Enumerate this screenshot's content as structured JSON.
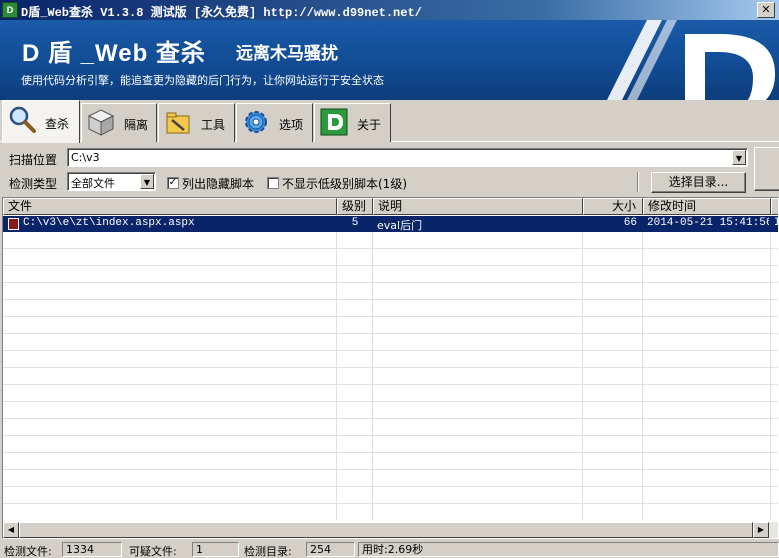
{
  "window": {
    "title": "D盾_Web查杀 V1.3.8 测试版 [永久免费] http://www.d99net.net/",
    "icon_text": "D"
  },
  "banner": {
    "brand": "D 盾 _Web 查杀",
    "slogan": "远离木马骚扰",
    "tagline": "使用代码分析引擎，能追查更为隐藏的后门行为，让你网站运行于安全状态",
    "logo_text": "D"
  },
  "tabs": [
    {
      "label": "查杀",
      "icon": "magnifier-icon",
      "active": true
    },
    {
      "label": "隔离",
      "icon": "box-icon",
      "active": false
    },
    {
      "label": "工具",
      "icon": "folder-tools-icon",
      "active": false
    },
    {
      "label": "选项",
      "icon": "gear-icon",
      "active": false
    },
    {
      "label": "关于",
      "icon": "d-logo-icon",
      "active": false
    }
  ],
  "form": {
    "scan_path_label": "扫描位置",
    "scan_path_value": "C:\\v3",
    "scan_type_label": "检测类型",
    "scan_type_value": "全部文件",
    "list_hidden_label": "列出隐藏脚本",
    "list_hidden_checked": true,
    "hide_low_label": "不显示低级别脚本(1级)",
    "hide_low_checked": false,
    "choose_dir_label": "选择目录..."
  },
  "table": {
    "columns": [
      "文件",
      "级别",
      "说明",
      "大小",
      "修改时间"
    ],
    "rows": [
      {
        "file": "C:\\v3\\e\\zt\\index.aspx.aspx",
        "level": "5",
        "desc": "eval后门",
        "size": "66",
        "mtime": "2014-05-21 15:41:56",
        "extra": "I"
      }
    ]
  },
  "status": {
    "scanned_files_label": "检测文件:",
    "scanned_files_value": "1334",
    "suspicious_label": "可疑文件:",
    "suspicious_value": "1",
    "scanned_dirs_label": "检测目录:",
    "scanned_dirs_value": "254",
    "elapsed": "用时:2.69秒"
  },
  "colors": {
    "banner": "#114a92",
    "selection": "#0a246a",
    "face": "#d4d0c8"
  }
}
